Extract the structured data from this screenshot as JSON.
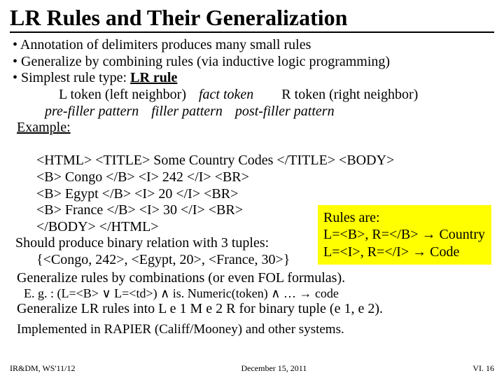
{
  "title": "LR Rules and Their Generalization",
  "bullets": {
    "b1": "• Annotation of delimiters produces many small rules",
    "b2": "• Generalize by combining rules (via inductive logic programming)",
    "b3_pre": "• Simplest rule type:  ",
    "b3_bold": "LR rule"
  },
  "schema": {
    "line1_l": "L token (left neighbor)",
    "line1_m": "fact token",
    "line1_r": "R token (right neighbor)",
    "line2_l": "pre-filler pattern",
    "line2_m": "filler pattern",
    "line2_r": "post-filler pattern"
  },
  "example_label": "Example:",
  "code": {
    "l1": "<HTML> <TITLE> Some Country Codes </TITLE> <BODY>",
    "l2": "<B> Congo </B> <I> 242 </I> <BR>",
    "l3": "<B> Egypt </B> <I> 20 </I> <BR>",
    "l4": "<B> France </B> <I> 30 </I> <BR>",
    "l5": "</BODY> </HTML>"
  },
  "should": "Should produce binary relation with 3 tuples:",
  "tuples": "{<Congo, 242>, <Egypt, 20>, <France, 30>}",
  "rulesbox": {
    "head": "Rules are:",
    "r1_pre": "L=<B>, R=</B> ",
    "r1_arrow": "→",
    "r1_post": " Country",
    "r2_pre": "L=<I>, R=</I> ",
    "r2_arrow": "→",
    "r2_post": " Code"
  },
  "gen1": "Generalize rules by combinations (or even FOL formulas).",
  "eg": {
    "pre": "E. g. : (L=<B> ",
    "or": "∨",
    "mid1": " L=<td>) ",
    "and1": "∧",
    "mid2": " is. Numeric(token) ",
    "and2": "∧",
    "mid3": " … ",
    "arrow": "→",
    "post": " code"
  },
  "gen2": "Generalize LR rules into L e 1 M e 2 R for binary tuple (e 1, e 2).",
  "impl": "Implemented in RAPIER (Califf/Mooney) and other systems.",
  "footer": {
    "left": "IR&DM, WS'11/12",
    "center": "December 15, 2011",
    "right": "VI. 16"
  }
}
